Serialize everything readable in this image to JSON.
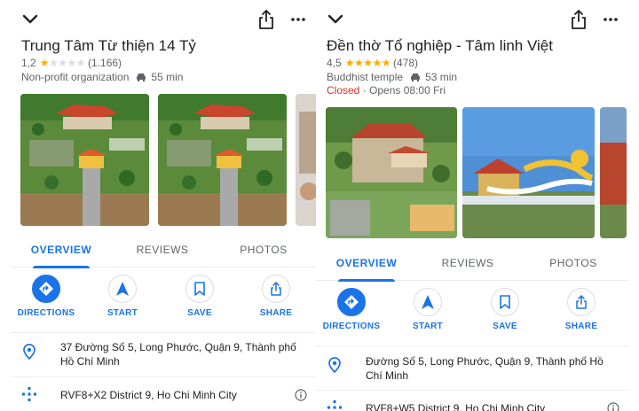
{
  "left": {
    "name": "Trung Tâm Từ thiện 14 Tỷ",
    "rating": "1,2",
    "rating_stars": 1.2,
    "review_count": "(1.166)",
    "category": "Non-profit organization",
    "drive_time": "55 min",
    "tabs": [
      "OVERVIEW",
      "REVIEWS",
      "PHOTOS"
    ],
    "actions": [
      "DIRECTIONS",
      "START",
      "SAVE",
      "SHARE"
    ],
    "address": "37 Đường Số 5, Long Phước, Quận 9, Thành phố Hồ Chí Minh",
    "plus_code": "RVF8+X2 District 9, Ho Chi Minh City"
  },
  "right": {
    "name": "Đền thờ Tổ nghiệp - Tâm linh Việt",
    "rating": "4,5",
    "rating_stars": 4.5,
    "review_count": "(478)",
    "category": "Buddhist temple",
    "drive_time": "53 min",
    "status_closed": "Closed",
    "status_opens": "· Opens 08:00 Fri",
    "tabs": [
      "OVERVIEW",
      "REVIEWS",
      "PHOTOS"
    ],
    "actions": [
      "DIRECTIONS",
      "START",
      "SAVE",
      "SHARE"
    ],
    "address": "Đường Số 5, Long Phước, Quận 9, Thành phố Hồ Chí Minh",
    "plus_code": "RVF8+W5 District 9, Ho Chi Minh City"
  },
  "icons": {
    "top_left": "chevron-down-icon",
    "top_share": "share-icon",
    "top_more": "more-horizontal-icon",
    "drive": "car-icon",
    "address": "location-pin-icon",
    "plus_code": "plus-code-icon",
    "info": "info-icon"
  },
  "colors": {
    "accent": "#1a73e8",
    "star": "#f9ab00",
    "closed": "#d93025",
    "secondary_text": "#5f6368"
  }
}
